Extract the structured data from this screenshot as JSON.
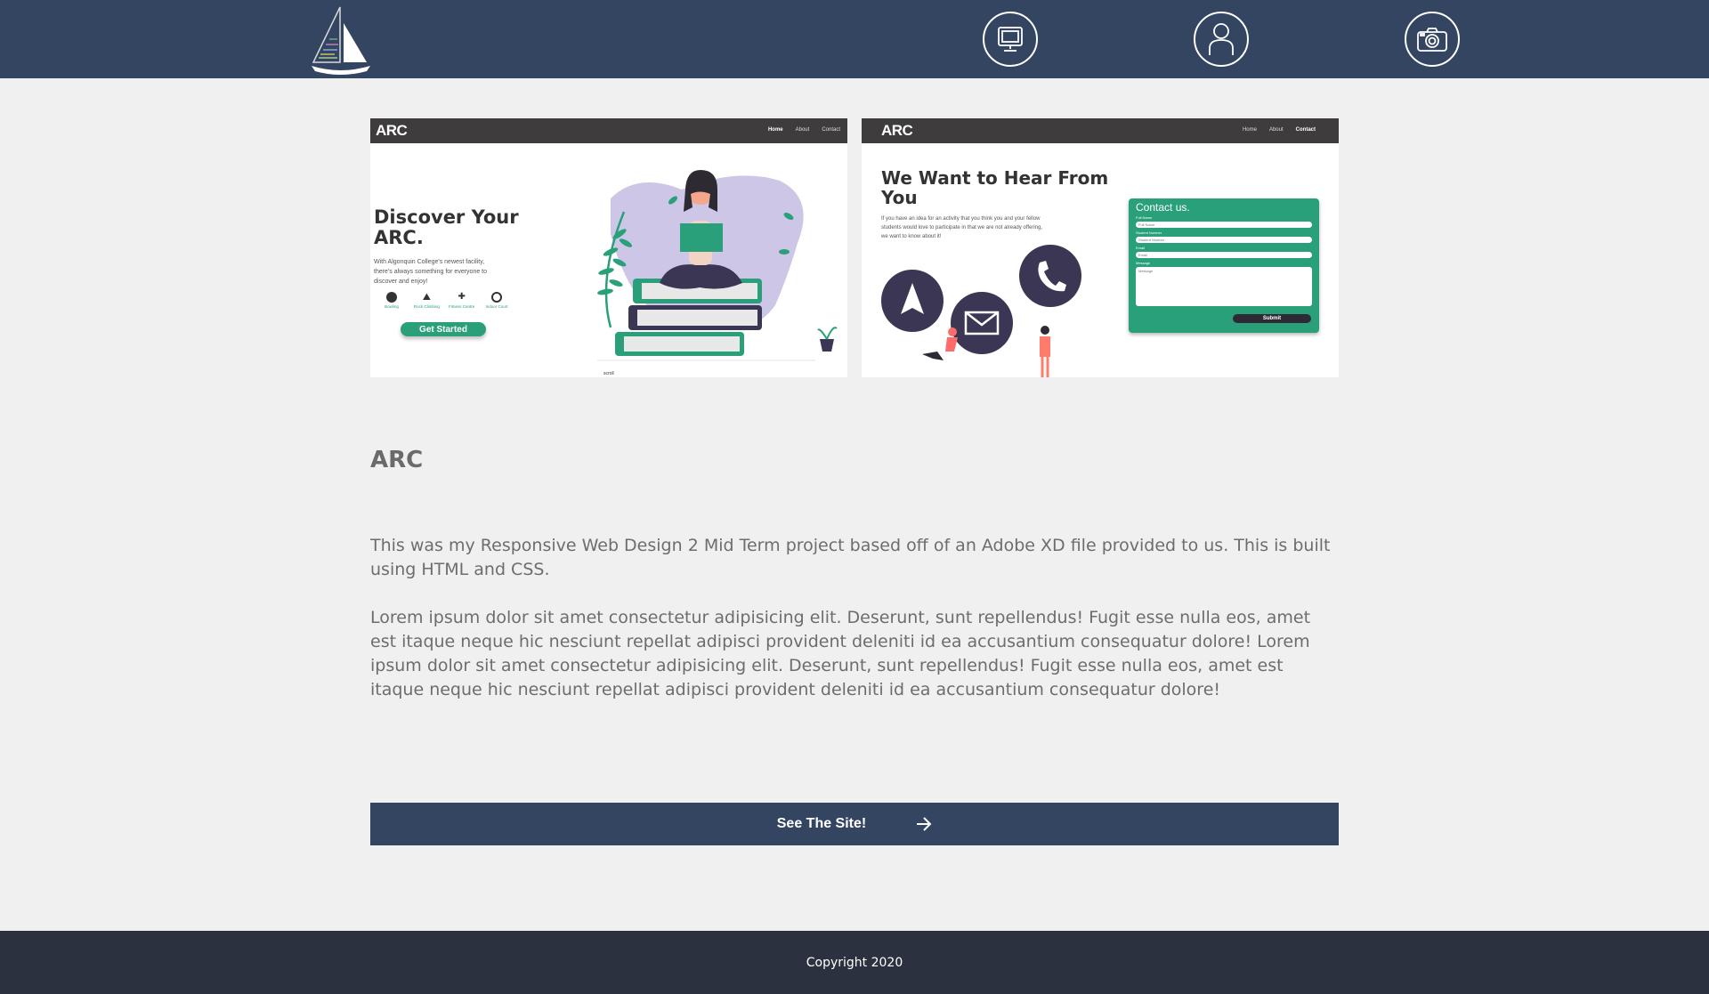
{
  "header": {
    "nav_icons": [
      "sailboat-logo-icon",
      "monitor-icon",
      "user-icon",
      "camera-icon"
    ]
  },
  "screenshot_left": {
    "logo": "ARC",
    "nav_links": [
      "Home",
      "About",
      "Contact"
    ],
    "heading_line1": "Discover Your",
    "heading_line2": "ARC.",
    "body_line1": "With Algonquin College's newest facility,",
    "body_line2": "there's always something for everyone to",
    "body_line3": "discover and enjoy!",
    "features": [
      "Bowling",
      "Rock Climbing",
      "Fitness Centre",
      "Indoor Court"
    ],
    "button": "Get Started",
    "scroll_label": "scroll"
  },
  "screenshot_right": {
    "logo": "ARC",
    "nav_links": [
      "Home",
      "About",
      "Contact"
    ],
    "heading_line1": "We Want to Hear From",
    "heading_line2": "You",
    "body_line1": "If you have an idea for an activity that you think you and your fellow",
    "body_line2": "students would love to participate in that we are not already offering,",
    "body_line3": "we want to know about it!",
    "form_title": "Contact us.",
    "fields": [
      {
        "label": "Full Name",
        "placeholder": "Full Name"
      },
      {
        "label": "Student Number",
        "placeholder": "Student Number"
      },
      {
        "label": "Email",
        "placeholder": "Email"
      },
      {
        "label": "Message",
        "placeholder": "Message"
      }
    ],
    "submit": "Submit"
  },
  "project": {
    "title": "ARC",
    "paragraph1": "This was my Responsive Web Design 2 Mid Term project based off of an Adobe XD file provided to us. This is built using HTML and CSS.",
    "paragraph2": "Lorem ipsum dolor sit amet consectetur adipisicing elit. Deserunt, sunt repellendus! Fugit esse nulla eos, amet est itaque neque hic nesciunt repellat adipisci provident deleniti id ea accusantium consequatur dolore! Lorem ipsum dolor sit amet consectetur adipisicing elit. Deserunt, sunt repellendus! Fugit esse nulla eos, amet est itaque neque hic nesciunt repellat adipisci provident deleniti id ea accusantium consequatur dolore!"
  },
  "cta": {
    "label": "See The Site!",
    "icon": "arrow-right-icon"
  },
  "footer": {
    "copyright": "Copyright 2020"
  },
  "colors": {
    "header_bg": "#344562",
    "page_bg": "#f0f0f0",
    "footer_bg": "#2b313e",
    "accent_green": "#2aa07a",
    "accent_purple": "#3a3654"
  }
}
